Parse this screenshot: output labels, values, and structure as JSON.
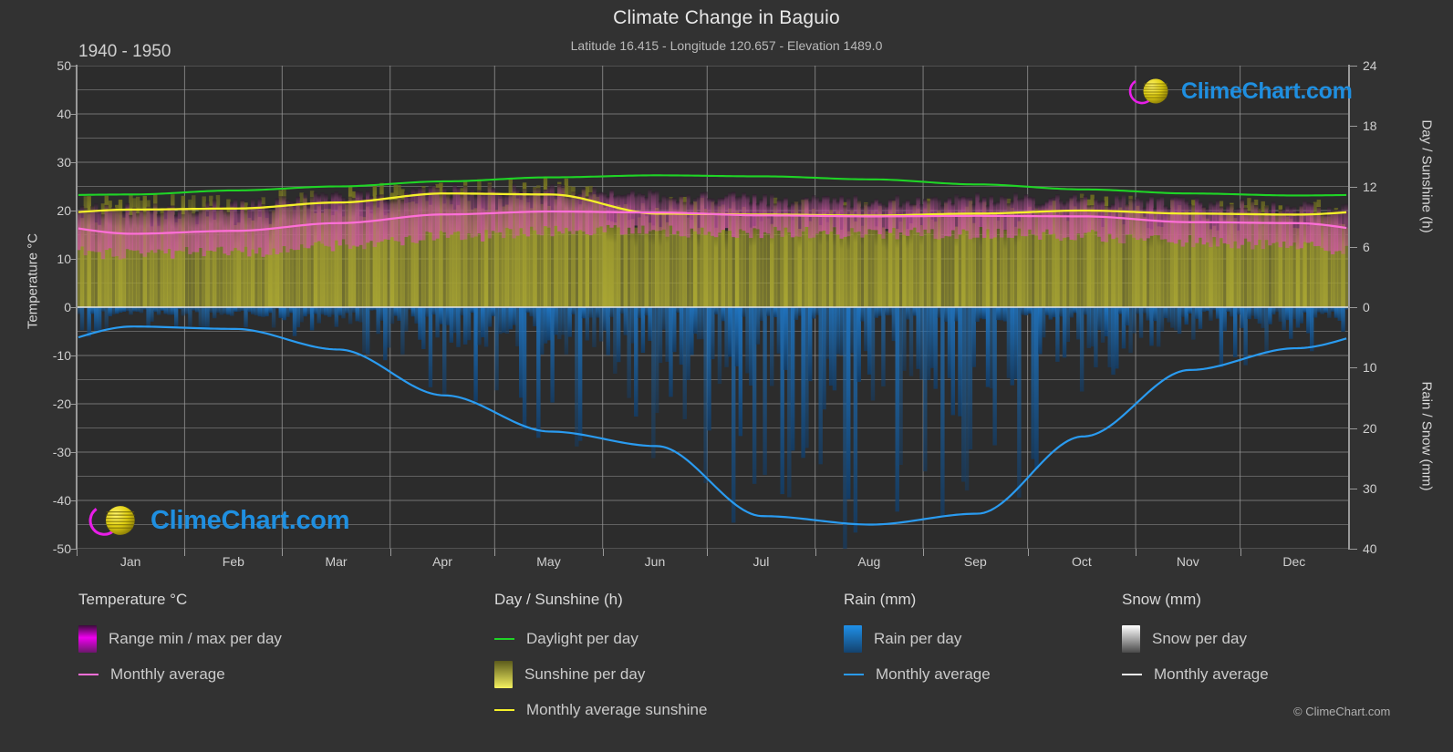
{
  "header": {
    "title": "Climate Change in Baguio",
    "subtitle": "Latitude 16.415 - Longitude 120.657 - Elevation 1489.0",
    "period": "1940 - 1950"
  },
  "watermark": {
    "text": "ClimeChart.com"
  },
  "copyright": "© ClimeChart.com",
  "axes": {
    "left_title": "Temperature °C",
    "right_top_title": "Day / Sunshine (h)",
    "right_bottom_title": "Rain / Snow (mm)",
    "left_ticks": [
      "50",
      "40",
      "30",
      "20",
      "10",
      "0",
      "-10",
      "-20",
      "-30",
      "-40",
      "-50"
    ],
    "right_top_ticks": [
      "24",
      "18",
      "12",
      "6",
      "0"
    ],
    "right_bottom_ticks": [
      "0",
      "10",
      "20",
      "30",
      "40"
    ],
    "x_ticks": [
      "Jan",
      "Feb",
      "Mar",
      "Apr",
      "May",
      "Jun",
      "Jul",
      "Aug",
      "Sep",
      "Oct",
      "Nov",
      "Dec"
    ]
  },
  "legend": {
    "temperature": {
      "title": "Temperature °C",
      "items": [
        {
          "label": "Range min / max per day",
          "marker": "gradient-swatch",
          "color": "#e400e4"
        },
        {
          "label": "Monthly average",
          "marker": "line",
          "color": "#ff6fd8"
        }
      ]
    },
    "day_sunshine": {
      "title": "Day / Sunshine (h)",
      "items": [
        {
          "label": "Daylight per day",
          "marker": "line",
          "color": "#1fd426"
        },
        {
          "label": "Sunshine per day",
          "marker": "gradient-swatch",
          "color": "#f2ef4a"
        },
        {
          "label": "Monthly average sunshine",
          "marker": "line",
          "color": "#f5f02a"
        }
      ]
    },
    "rain": {
      "title": "Rain (mm)",
      "items": [
        {
          "label": "Rain per day",
          "marker": "gradient-swatch",
          "color": "#1f8fe0"
        },
        {
          "label": "Monthly average",
          "marker": "line",
          "color": "#2a9bf0"
        }
      ]
    },
    "snow": {
      "title": "Snow (mm)",
      "items": [
        {
          "label": "Snow per day",
          "marker": "gradient-swatch",
          "color": "#f2f2f2"
        },
        {
          "label": "Monthly average",
          "marker": "line",
          "color": "#f2f2f2"
        }
      ]
    }
  },
  "chart_data": {
    "type": "area",
    "title": "Climate Change in Baguio",
    "subtitle": "Latitude 16.415 - Longitude 120.657 - Elevation 1489.0",
    "period": "1940 - 1950",
    "xlabel": "",
    "ylabel": "Temperature °C",
    "ylim": [
      -50,
      50
    ],
    "y2lim_top": [
      0,
      24
    ],
    "y2lim_bottom": [
      0,
      40
    ],
    "grid": true,
    "legend_position": "below",
    "categories": [
      "Jan",
      "Feb",
      "Mar",
      "Apr",
      "May",
      "Jun",
      "Jul",
      "Aug",
      "Sep",
      "Oct",
      "Nov",
      "Dec"
    ],
    "series": [
      {
        "name": "Monthly average temperature",
        "unit": "°C",
        "axis": "left",
        "color": "#ff6fd8",
        "values": [
          15.2,
          15.8,
          17.4,
          19.2,
          19.8,
          19.6,
          19.0,
          18.8,
          18.9,
          18.8,
          17.6,
          17.4
        ]
      },
      {
        "name": "Range min per day",
        "unit": "°C",
        "axis": "left",
        "color": "#e400e4",
        "values": [
          11.0,
          11.4,
          12.8,
          14.6,
          15.6,
          15.8,
          15.4,
          15.3,
          15.3,
          14.9,
          13.6,
          12.4
        ]
      },
      {
        "name": "Range max per day",
        "unit": "°C",
        "axis": "left",
        "color": "#e400e4",
        "values": [
          20.2,
          21.0,
          22.6,
          24.2,
          24.4,
          23.2,
          22.4,
          22.2,
          22.4,
          22.4,
          21.6,
          20.8
        ]
      },
      {
        "name": "Daylight per day",
        "unit": "h",
        "axis": "right_top",
        "color": "#1fd426",
        "values": [
          11.2,
          11.6,
          12.0,
          12.5,
          12.9,
          13.1,
          13.0,
          12.7,
          12.2,
          11.7,
          11.3,
          11.1
        ]
      },
      {
        "name": "Monthly average sunshine",
        "unit": "h",
        "axis": "right_top",
        "color": "#f5f02a",
        "values": [
          9.7,
          9.8,
          10.4,
          11.3,
          11.2,
          9.3,
          9.2,
          9.1,
          9.3,
          9.6,
          9.3,
          9.2
        ]
      },
      {
        "name": "Monthly average rain",
        "unit": "mm",
        "axis": "right_bottom",
        "color": "#2a9bf0",
        "values": [
          3.2,
          3.6,
          7.0,
          14.6,
          20.6,
          23.0,
          34.6,
          36.0,
          34.2,
          21.4,
          10.4,
          6.8
        ]
      },
      {
        "name": "Monthly average snow",
        "unit": "mm",
        "axis": "right_bottom",
        "color": "#f2f2f2",
        "values": [
          0,
          0,
          0,
          0,
          0,
          0,
          0,
          0,
          0,
          0,
          0,
          0
        ]
      }
    ]
  }
}
